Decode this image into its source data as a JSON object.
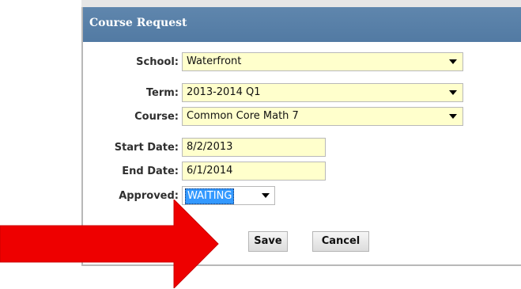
{
  "dialog": {
    "title": "Course Request"
  },
  "form": {
    "school": {
      "label": "School:",
      "value": "Waterfront"
    },
    "term": {
      "label": "Term:",
      "value": "2013-2014 Q1"
    },
    "course": {
      "label": "Course:",
      "value": "Common Core Math 7"
    },
    "start_date": {
      "label": "Start Date:",
      "value": "8/2/2013"
    },
    "end_date": {
      "label": "End Date:",
      "value": "6/1/2014"
    },
    "approved": {
      "label": "Approved:",
      "value": "WAITING"
    }
  },
  "buttons": {
    "save_label": "Save",
    "cancel_label": "Cancel"
  },
  "colors": {
    "titlebar": "#527aa3",
    "field_bg": "#ffffcc",
    "selection": "#3399ff",
    "arrow": "#ee0000"
  },
  "icons": {
    "dropdown": "chevron-down-icon",
    "pointer": "red-arrow-icon"
  }
}
